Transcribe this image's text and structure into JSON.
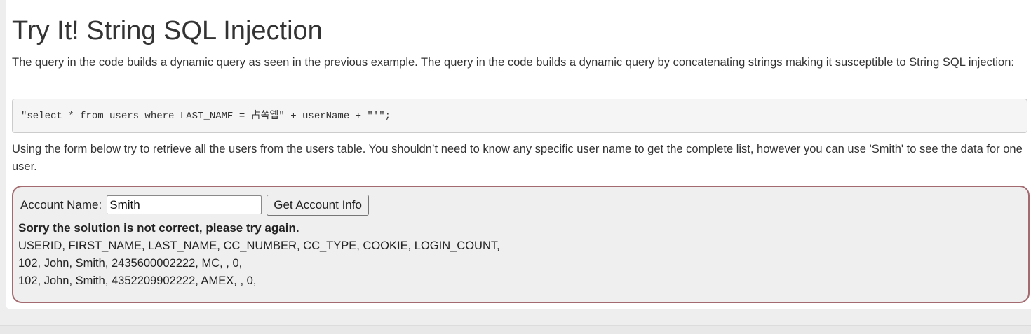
{
  "lesson": {
    "title": "Try It! String SQL Injection",
    "intro": "The query in the code builds a dynamic query as seen in the previous example. The query in the code builds a dynamic query by concatenating strings making it susceptible to String SQL injection:",
    "code": "\"select * from users where LAST_NAME = 占쏙옙\" + userName + \"'\";",
    "instructions": "Using the form below try to retrieve all the users from the users table. You shouldn’t need to know any specific user name to get the complete list, however you can use 'Smith' to see the data for one user."
  },
  "form": {
    "account_label": "Account Name:",
    "account_value": "Smith",
    "submit_label": "Get Account Info"
  },
  "result": {
    "feedback": "Sorry the solution is not correct, please try again.",
    "lines": [
      "USERID, FIRST_NAME, LAST_NAME, CC_NUMBER, CC_TYPE, COOKIE, LOGIN_COUNT,",
      "102, John, Smith, 2435600002222, MC, , 0,",
      "102, John, Smith, 4352209902222, AMEX, , 0,"
    ]
  },
  "colors": {
    "attack_border": "#a36a70",
    "attack_background": "#efefef",
    "code_background": "#f5f5f5"
  }
}
